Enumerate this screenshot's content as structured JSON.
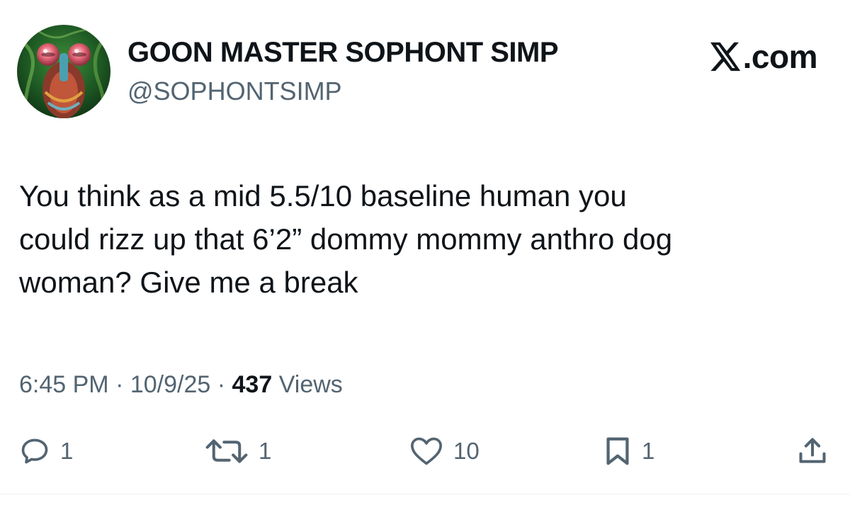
{
  "author": {
    "display_name": "GOON MASTER SOPHONT SIMP",
    "handle": "@SOPHONTSIMP",
    "avatar_icon": "mantis-shrimp-avatar"
  },
  "brand": {
    "icon": "x-logo-icon",
    "text": ".com"
  },
  "tweet": {
    "lines": [
      "You think as a mid 5.5/10 baseline human you",
      "could rizz up that 6’2” dommy mommy anthro dog",
      "woman? Give me a break"
    ]
  },
  "meta": {
    "time": "6:45 PM",
    "sep1": " · ",
    "date": "10/9/25",
    "sep2": " · ",
    "views_count": "437",
    "views_label": " Views"
  },
  "actions": {
    "reply": {
      "icon": "reply-icon",
      "count": "1"
    },
    "repost": {
      "icon": "repost-icon",
      "count": "1"
    },
    "like": {
      "icon": "heart-icon",
      "count": "10"
    },
    "bookmark": {
      "icon": "bookmark-icon",
      "count": "1"
    },
    "share": {
      "icon": "share-icon"
    }
  },
  "colors": {
    "text_primary": "#0f1419",
    "text_secondary": "#536471",
    "divider": "#eff3f4"
  }
}
